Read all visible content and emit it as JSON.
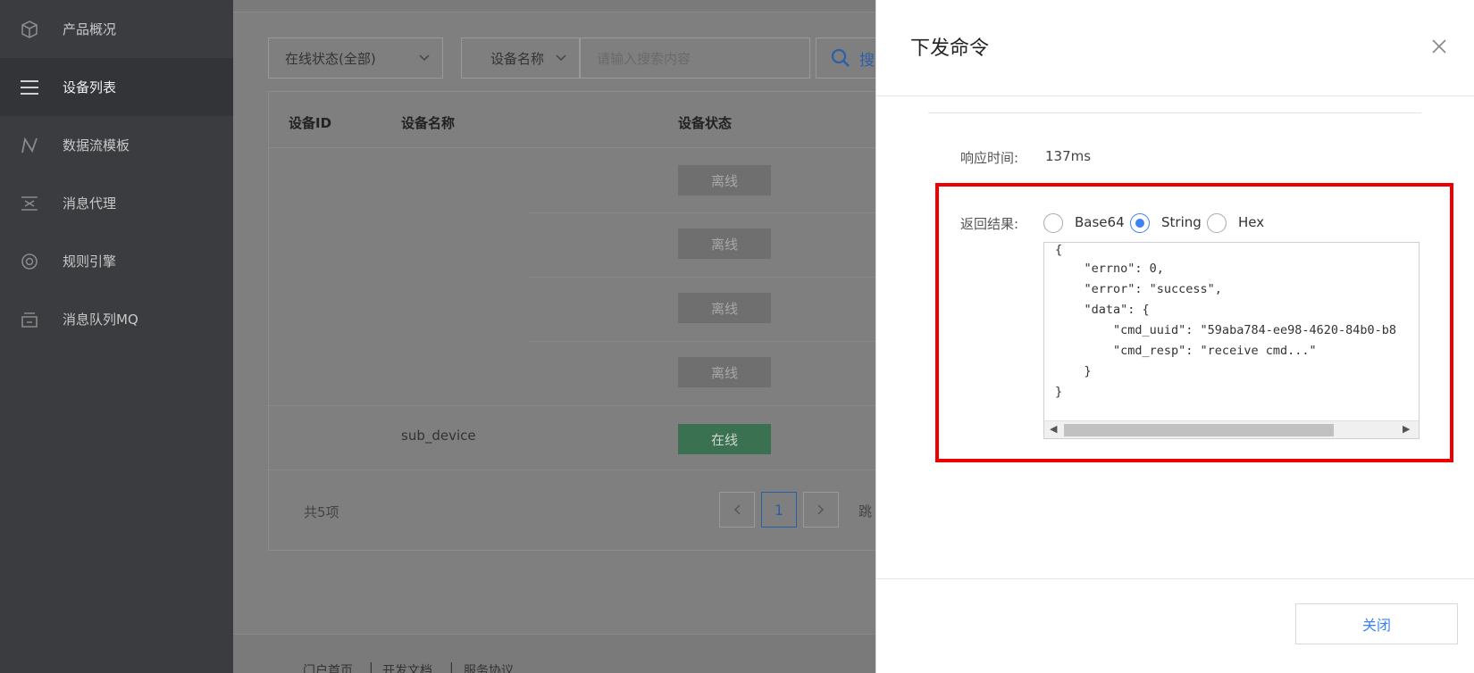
{
  "sidebar": {
    "items": [
      {
        "label": "产品概况",
        "icon": "cube-icon"
      },
      {
        "label": "设备列表",
        "icon": "list-icon"
      },
      {
        "label": "数据流模板",
        "icon": "flow-icon"
      },
      {
        "label": "消息代理",
        "icon": "proxy-icon"
      },
      {
        "label": "规则引擎",
        "icon": "rule-icon"
      },
      {
        "label": "消息队列MQ",
        "icon": "queue-icon"
      }
    ],
    "active_index": 1
  },
  "toolbar": {
    "status_filter": "在线状态(全部)",
    "search_field": "设备名称",
    "search_placeholder": "请输入搜索内容",
    "search_button": "搜"
  },
  "table": {
    "headers": [
      "设备ID",
      "设备名称",
      "设备状态"
    ],
    "rows": [
      {
        "id": "",
        "name": "",
        "status": "离线"
      },
      {
        "id": "",
        "name": "",
        "status": "离线"
      },
      {
        "id": "",
        "name": "",
        "status": "离线"
      },
      {
        "id": "",
        "name": "",
        "status": "离线"
      },
      {
        "id": "",
        "name": "sub_device",
        "status": "在线"
      }
    ],
    "total": "共5项",
    "current_page": "1",
    "jump_label": "跳"
  },
  "footer": {
    "links": [
      "门户首页",
      "开发文档",
      "服务协议"
    ]
  },
  "drawer": {
    "title": "下发命令",
    "response_time_label": "响应时间:",
    "response_time_value": "137ms",
    "result_label": "返回结果:",
    "formats": [
      "Base64",
      "String",
      "Hex"
    ],
    "selected_format": "String",
    "result_lines": [
      "{",
      "    \"errno\": 0,",
      "    \"error\": \"success\",",
      "    \"data\": {",
      "        \"cmd_uuid\": \"59aba784-ee98-4620-84b0-b8",
      "        \"cmd_resp\": \"receive cmd...\"",
      "    }",
      "}"
    ],
    "close_button": "关闭"
  }
}
